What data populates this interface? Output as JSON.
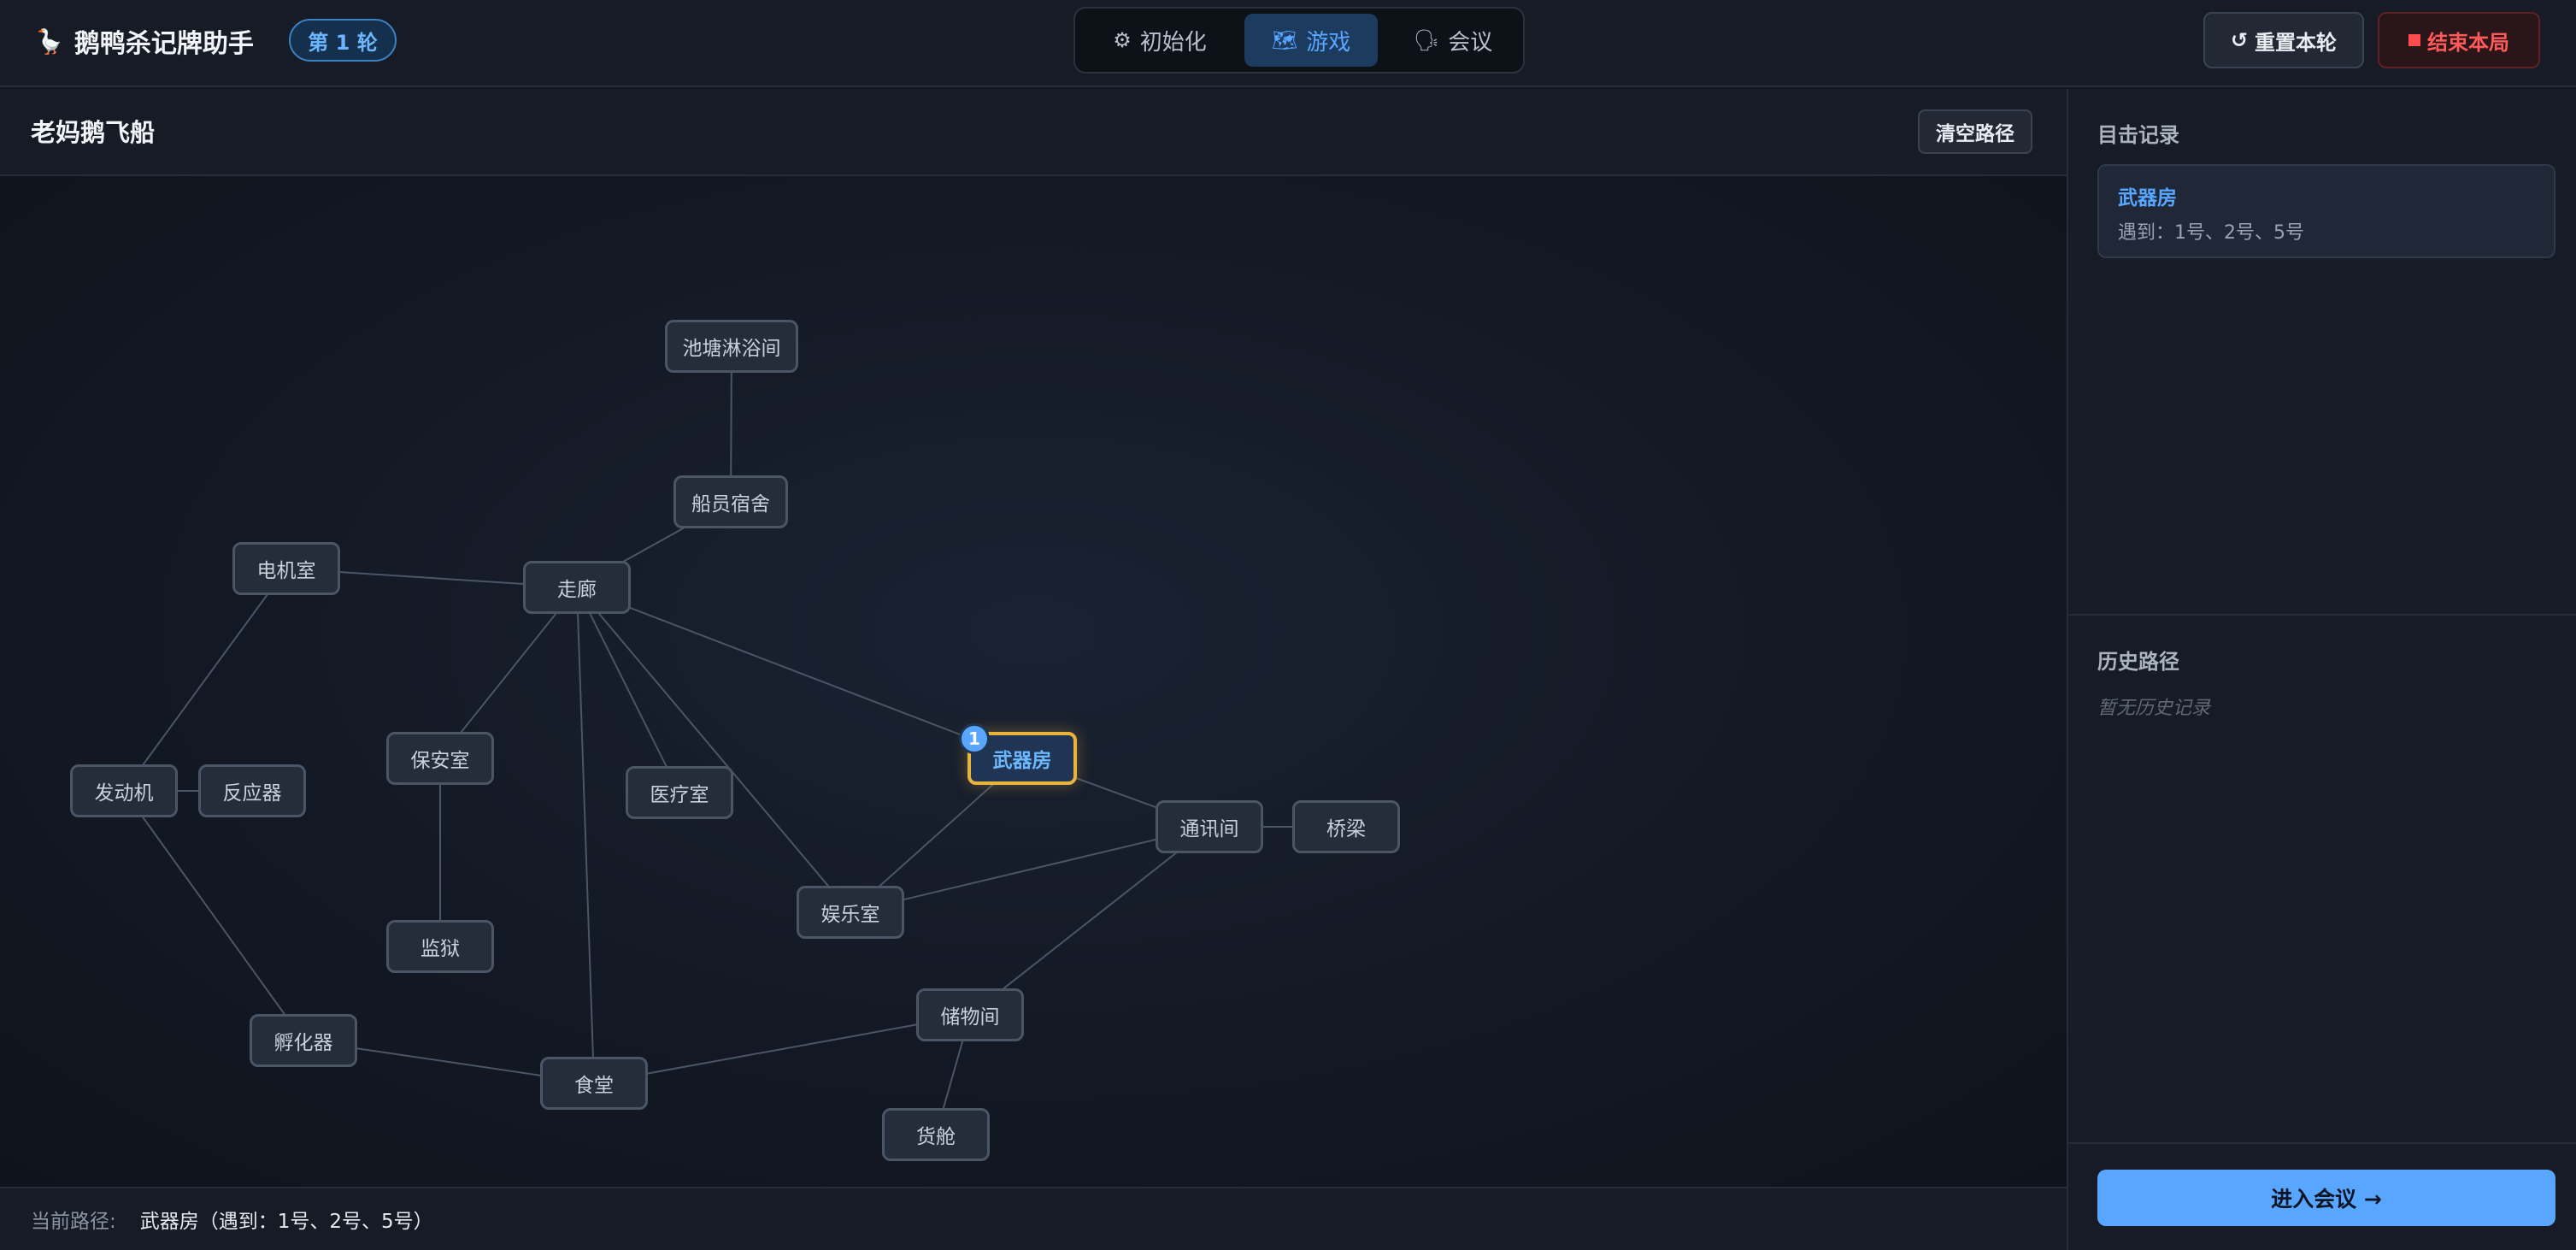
{
  "header": {
    "logo_icon": "goose-icon",
    "logo_glyph": "🪿",
    "title": "鹅鸭杀记牌助手",
    "round_badge": "第 1 轮",
    "tabs": [
      {
        "icon": "gear-icon",
        "glyph": "⚙",
        "label": "初始化",
        "active": false
      },
      {
        "icon": "map-icon",
        "glyph": "🗺",
        "label": "游戏",
        "active": true
      },
      {
        "icon": "chat-icon",
        "glyph": "🗣",
        "label": "会议",
        "active": false
      }
    ],
    "reset_icon": "↺",
    "reset_label": "重置本轮",
    "end_label": "结束本局"
  },
  "map": {
    "name": "老妈鹅飞船",
    "clear_label": "清空路径",
    "rooms": [
      {
        "id": "pond",
        "label": "池塘淋浴间"
      },
      {
        "id": "dorm",
        "label": "船员宿舍"
      },
      {
        "id": "motor",
        "label": "电机室"
      },
      {
        "id": "hall",
        "label": "走廊"
      },
      {
        "id": "engine",
        "label": "发动机"
      },
      {
        "id": "reactor",
        "label": "反应器"
      },
      {
        "id": "security",
        "label": "保安室"
      },
      {
        "id": "medbay",
        "label": "医疗室"
      },
      {
        "id": "armory",
        "label": "武器房",
        "selected": true,
        "visit_count": 1
      },
      {
        "id": "comms",
        "label": "通讯间"
      },
      {
        "id": "bridge",
        "label": "桥梁"
      },
      {
        "id": "rec",
        "label": "娱乐室"
      },
      {
        "id": "prison",
        "label": "监狱"
      },
      {
        "id": "storage",
        "label": "储物间"
      },
      {
        "id": "incubator",
        "label": "孵化器"
      },
      {
        "id": "cafeteria",
        "label": "食堂"
      },
      {
        "id": "cargo",
        "label": "货舱"
      }
    ],
    "connections": [
      [
        "pond",
        "dorm"
      ],
      [
        "dorm",
        "hall"
      ],
      [
        "motor",
        "hall"
      ],
      [
        "motor",
        "engine"
      ],
      [
        "engine",
        "reactor"
      ],
      [
        "engine",
        "incubator"
      ],
      [
        "hall",
        "security"
      ],
      [
        "hall",
        "medbay"
      ],
      [
        "hall",
        "rec"
      ],
      [
        "hall",
        "armory"
      ],
      [
        "hall",
        "cafeteria"
      ],
      [
        "security",
        "prison"
      ],
      [
        "armory",
        "comms"
      ],
      [
        "armory",
        "rec"
      ],
      [
        "comms",
        "bridge"
      ],
      [
        "comms",
        "rec"
      ],
      [
        "comms",
        "storage"
      ],
      [
        "storage",
        "cafeteria"
      ],
      [
        "storage",
        "cargo"
      ],
      [
        "incubator",
        "cafeteria"
      ]
    ],
    "path_label": "当前路径:",
    "path_value": "武器房（遇到：1号、2号、5号）"
  },
  "sidebar": {
    "witness_title": "目击记录",
    "witness_entries": [
      {
        "room": "武器房",
        "detail": "遇到：1号、2号、5号"
      }
    ],
    "history_title": "历史路径",
    "history_empty": "暂无历史记录",
    "meeting_label": "进入会议 →"
  },
  "colors": {
    "accent": "#58a6ff",
    "selected_border": "#e9b43c",
    "danger": "#ff5a5a"
  }
}
